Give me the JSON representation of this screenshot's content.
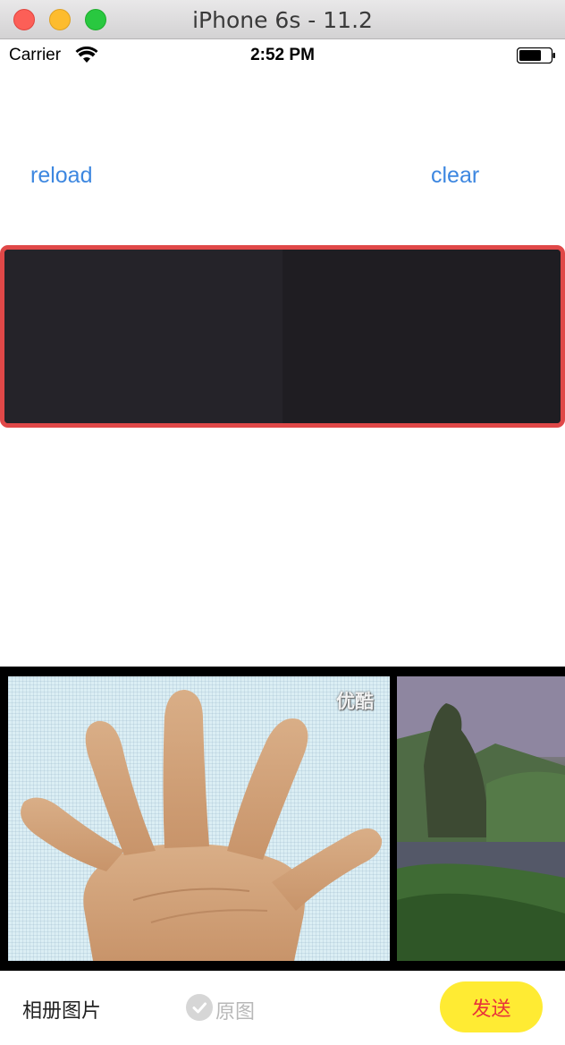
{
  "window": {
    "title": "iPhone 6s - 11.2"
  },
  "status_bar": {
    "carrier": "Carrier",
    "time": "2:52 PM",
    "wifi_icon": "wifi-icon",
    "battery_icon": "battery-icon"
  },
  "toolbar_top": {
    "reload_label": "reload",
    "clear_label": "clear",
    "accent_color": "#3d87e0"
  },
  "preview": {
    "selection_color": "#e04848"
  },
  "photos": {
    "items": [
      {
        "watermark": "优酷"
      },
      {
        "watermark": ""
      }
    ]
  },
  "bottom_bar": {
    "album_label": "相册图片",
    "original_label": "原图",
    "original_checked": false,
    "send_label": "发送",
    "send_color": "#ffeb33"
  }
}
